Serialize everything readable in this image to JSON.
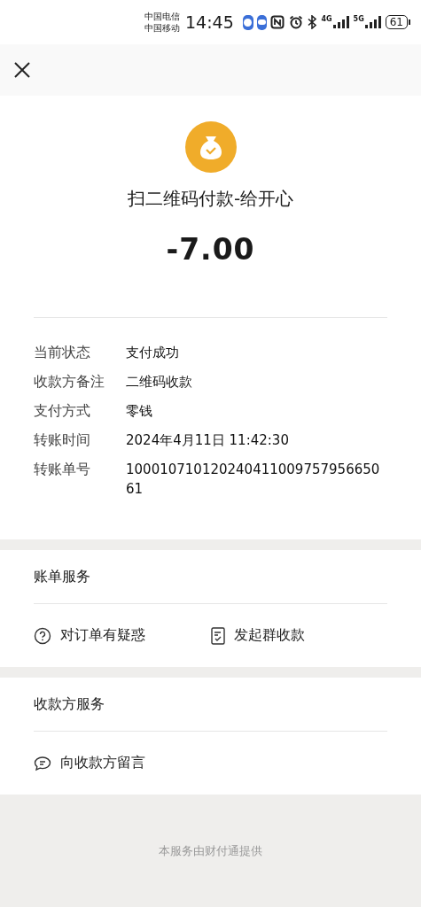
{
  "status_bar": {
    "carriers": [
      "中国电信",
      "中国移动"
    ],
    "time": "14:45",
    "networks": [
      "4G",
      "5G"
    ],
    "battery": "61"
  },
  "payment": {
    "title": "扫二维码付款-给开心",
    "amount": "-7.00"
  },
  "details": [
    {
      "label": "当前状态",
      "value": "支付成功"
    },
    {
      "label": "收款方备注",
      "value": "二维码收款"
    },
    {
      "label": "支付方式",
      "value": "零钱"
    },
    {
      "label": "转账时间",
      "value": "2024年4月11日 11:42:30"
    },
    {
      "label": "转账单号",
      "value": "10001071012024041100975795665061"
    }
  ],
  "sections": [
    {
      "title": "账单服务",
      "actions": [
        {
          "kind": "question",
          "label": "对订单有疑惑"
        },
        {
          "kind": "document",
          "label": "发起群收款"
        }
      ]
    },
    {
      "title": "收款方服务",
      "actions": [
        {
          "kind": "chat",
          "label": "向收款方留言"
        }
      ]
    }
  ],
  "footer": "本服务由财付通提供"
}
